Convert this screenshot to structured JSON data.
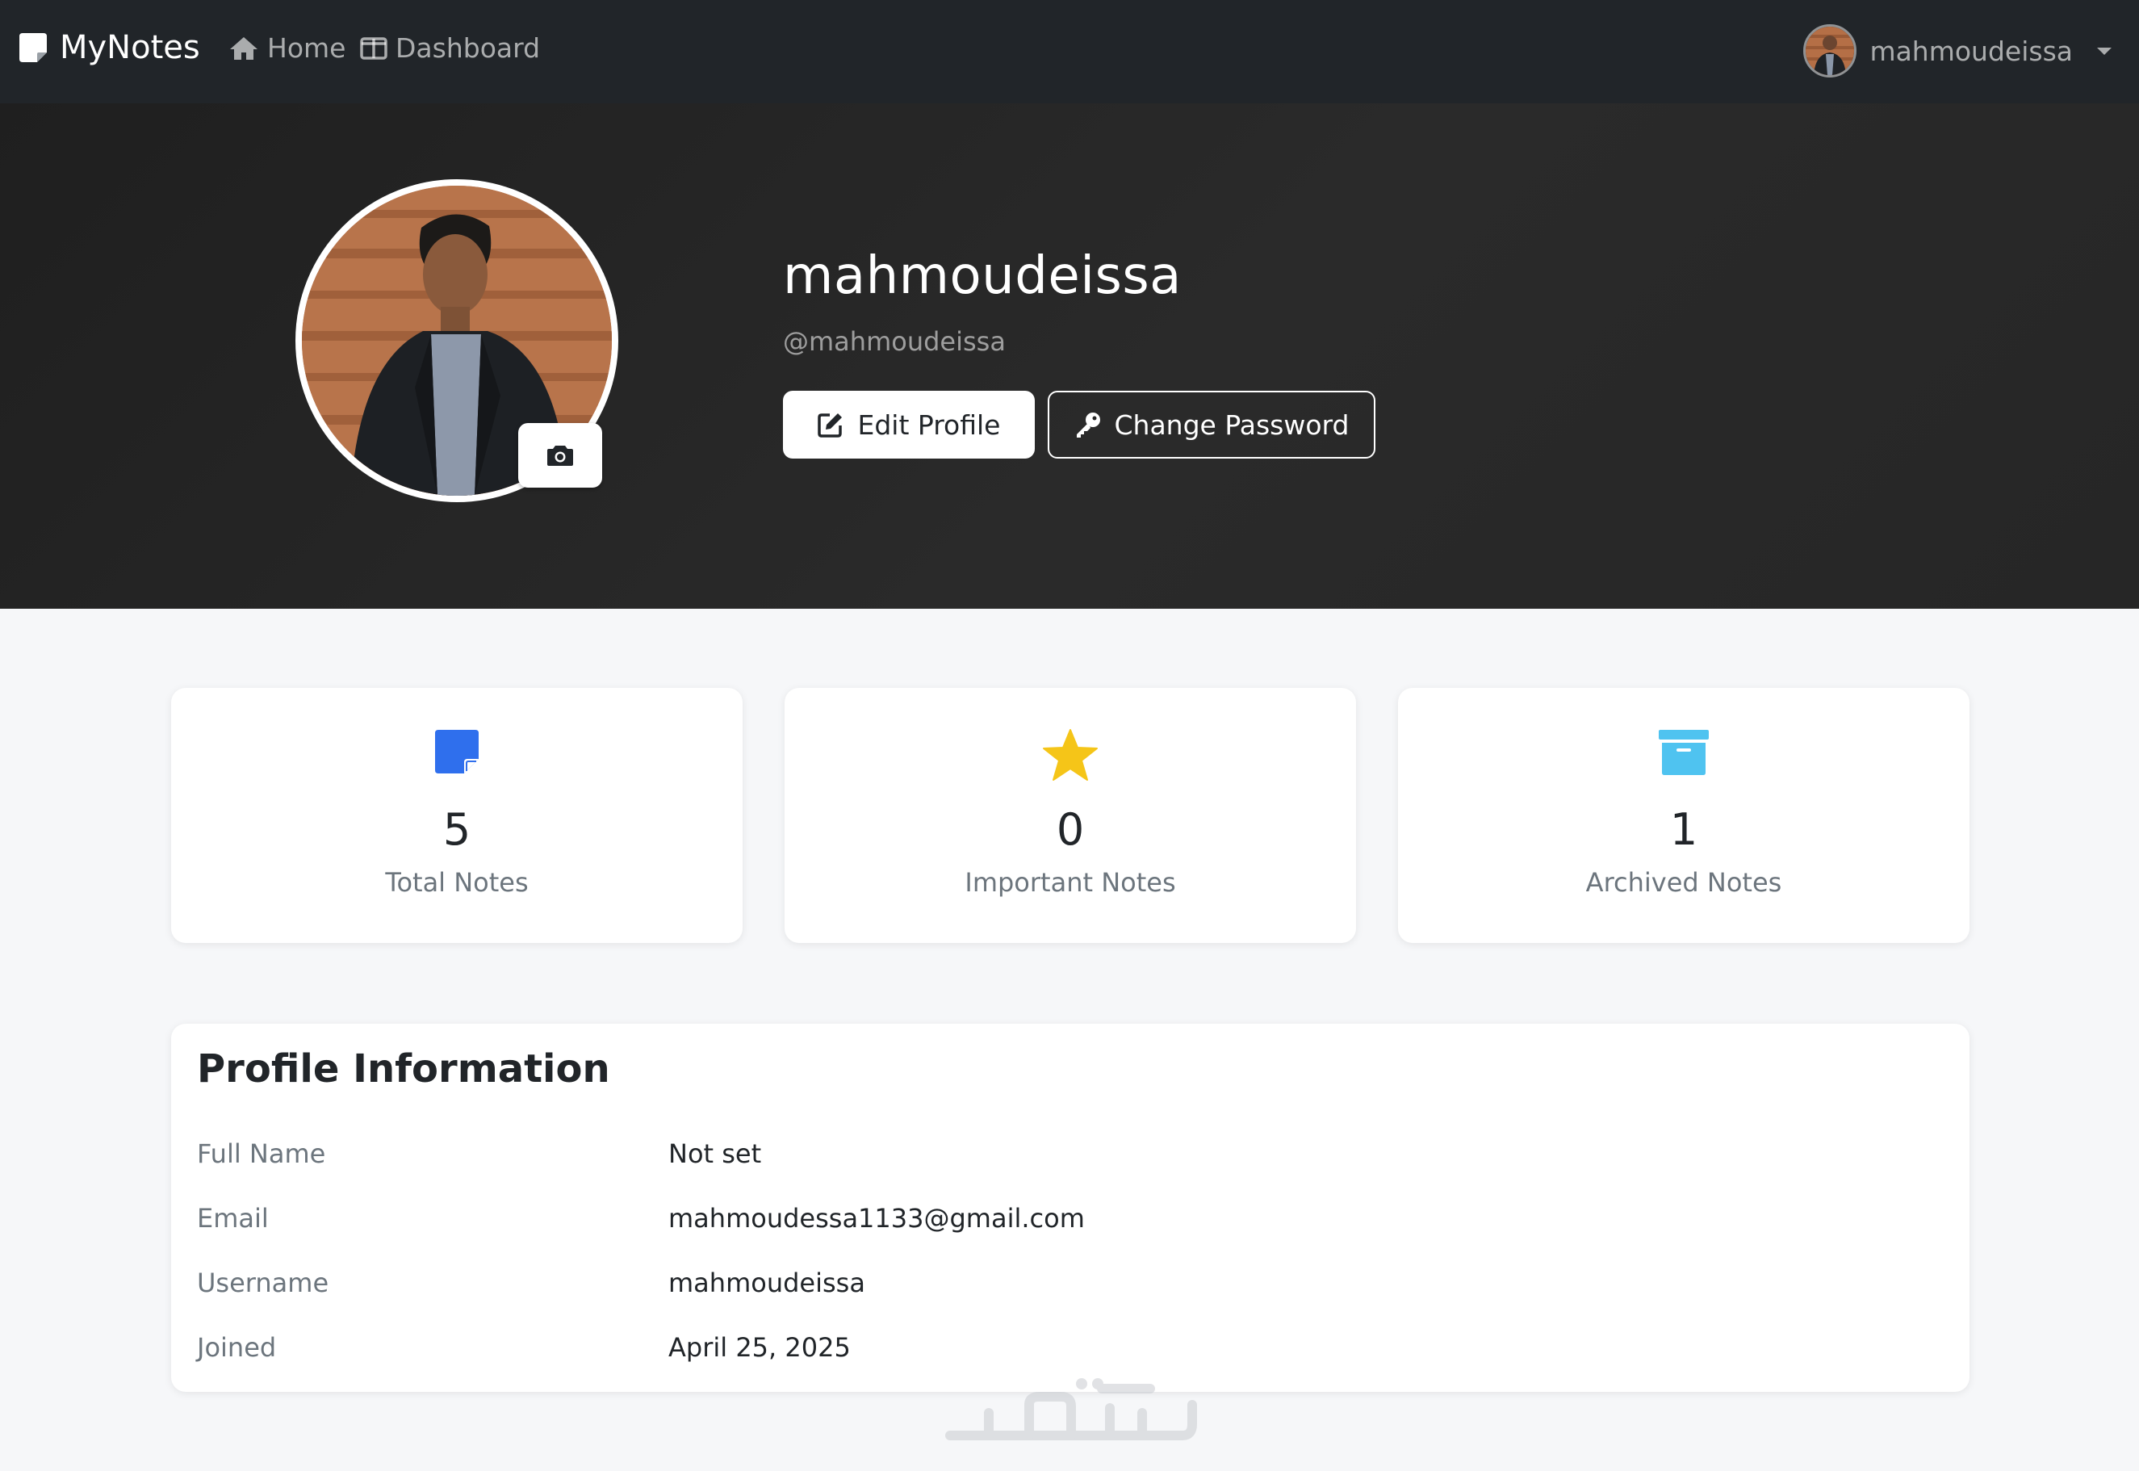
{
  "navbar": {
    "brand": "MyNotes",
    "links": [
      {
        "label": "Home",
        "icon": "home-icon"
      },
      {
        "label": "Dashboard",
        "icon": "columns-icon"
      }
    ],
    "user": {
      "name": "mahmoudeissa"
    }
  },
  "hero": {
    "name": "mahmoudeissa",
    "handle": "@mahmoudeissa",
    "edit_label": "Edit Profile",
    "password_label": "Change Password"
  },
  "stats": [
    {
      "value": "5",
      "label": "Total Notes",
      "icon": "sticky-note-icon",
      "color": "#2f6fed"
    },
    {
      "value": "0",
      "label": "Important Notes",
      "icon": "star-icon",
      "color": "#f5c518"
    },
    {
      "value": "1",
      "label": "Archived Notes",
      "icon": "archive-icon",
      "color": "#4fc3f0"
    }
  ],
  "profile_info": {
    "title": "Profile Information",
    "rows": [
      {
        "label": "Full Name",
        "value": "Not set"
      },
      {
        "label": "Email",
        "value": "mahmoudessa1133@gmail.com"
      },
      {
        "label": "Username",
        "value": "mahmoudeissa"
      },
      {
        "label": "Joined",
        "value": "April 25, 2025"
      }
    ]
  },
  "colors": {
    "navbar_bg": "#212529",
    "hero_bg": "#232323",
    "page_bg": "#f6f7f9",
    "primary": "#2f6fed",
    "warning": "#f5c518",
    "info": "#4fc3f0"
  }
}
